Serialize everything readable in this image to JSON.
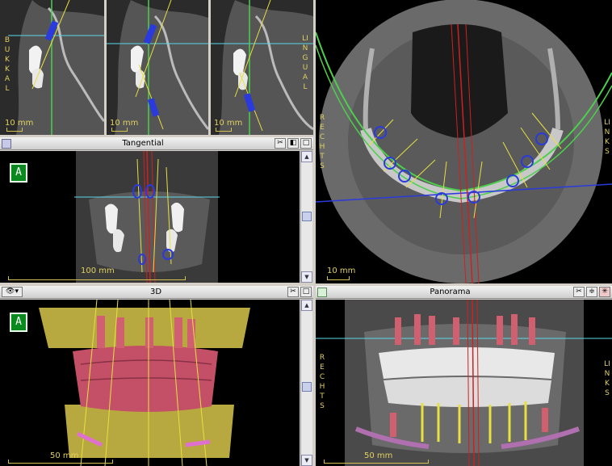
{
  "views": {
    "cross_left_scale": "10 mm",
    "cross_mid_scale": "10 mm",
    "cross_right_scale": "10 mm",
    "buccal_label": "BUKKAL",
    "lingual_label": "LINGUAL"
  },
  "tangential": {
    "title": "Tangential",
    "scale": "100 mm",
    "badge": "A"
  },
  "axial": {
    "right_label": "RECHTS",
    "left_label": "LINKS",
    "scale": "10 mm"
  },
  "three_d": {
    "title": "3D",
    "scale": "50 mm",
    "badge": "A"
  },
  "panorama": {
    "title": "Panorama",
    "right_label": "RECHTS",
    "left_label": "LINKS",
    "scale": "50 mm"
  },
  "colors": {
    "nerve_green": "#4cd04c",
    "implant_blue": "#2a3adc",
    "guide_yellow": "#e8e040",
    "axis_red": "#d02020",
    "reference_cyan": "#5ad8e8"
  }
}
